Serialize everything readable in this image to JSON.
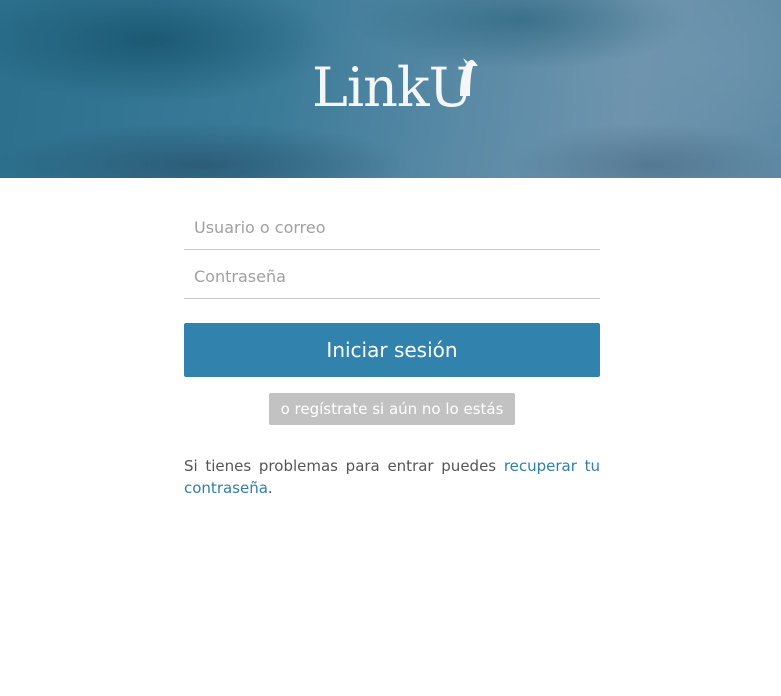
{
  "brand": {
    "logo_text": "LinkU"
  },
  "login_form": {
    "username_placeholder": "Usuario o correo",
    "password_placeholder": "Contraseña",
    "submit_label": "Iniciar sesión",
    "register_label": "o regístrate si aún no lo estás"
  },
  "help": {
    "text": "Si tienes problemas para entrar puedes ",
    "link_label": "recuperar tu contraseña",
    "suffix": "."
  },
  "colors": {
    "primary_button": "#3183ad",
    "secondary_button": "#c2c2c2",
    "link": "#2f7fab",
    "header_base": "#3a7b98"
  },
  "icons": {
    "logo_mark": "bird-icon"
  }
}
